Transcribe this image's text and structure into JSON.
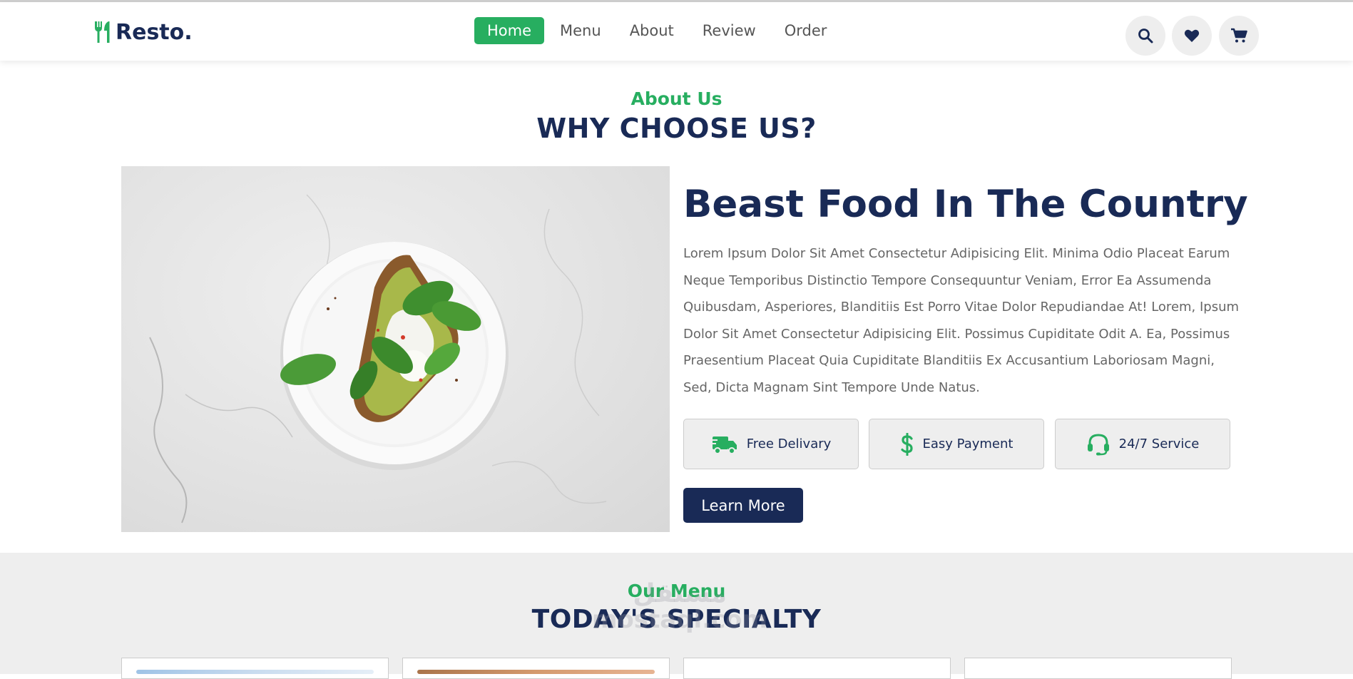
{
  "header": {
    "logo_text": "Resto.",
    "nav": [
      {
        "label": "Home",
        "active": true
      },
      {
        "label": "Menu",
        "active": false
      },
      {
        "label": "About",
        "active": false
      },
      {
        "label": "Review",
        "active": false
      },
      {
        "label": "Order",
        "active": false
      }
    ],
    "icons": [
      "search-icon",
      "heart-icon",
      "cart-icon"
    ]
  },
  "about": {
    "sub_heading": "About Us",
    "heading": "WHY CHOOSE US?",
    "title": "Beast Food In The Country",
    "text": "Lorem Ipsum Dolor Sit Amet Consectetur Adipisicing Elit. Minima Odio Placeat Earum Neque Temporibus Distinctio Tempore Consequuntur Veniam, Error Ea Assumenda Quibusdam, Asperiores, Blanditiis Est Porro Vitae Dolor Repudiandae At! Lorem, Ipsum Dolor Sit Amet Consectetur Adipisicing Elit. Possimus Cupiditate Odit A. Ea, Possimus Praesentium Placeat Quia Cupiditate Blanditiis Ex Accusantium Laboriosam Magni, Sed, Dicta Magnam Sint Tempore Unde Natus.",
    "features": [
      {
        "label": "Free Delivary",
        "icon": "truck-icon"
      },
      {
        "label": "Easy Payment",
        "icon": "dollar-icon"
      },
      {
        "label": "24/7 Service",
        "icon": "headset-icon"
      }
    ],
    "button": "Learn More"
  },
  "menu": {
    "sub_heading": "Our Menu",
    "heading": "TODAY'S SPECIALTY"
  },
  "watermark": {
    "line1": "مستقل",
    "line2": "mostaql.com"
  },
  "colors": {
    "accent": "#27ae60",
    "primary": "#192a56",
    "light_bg": "#eeeeee"
  }
}
